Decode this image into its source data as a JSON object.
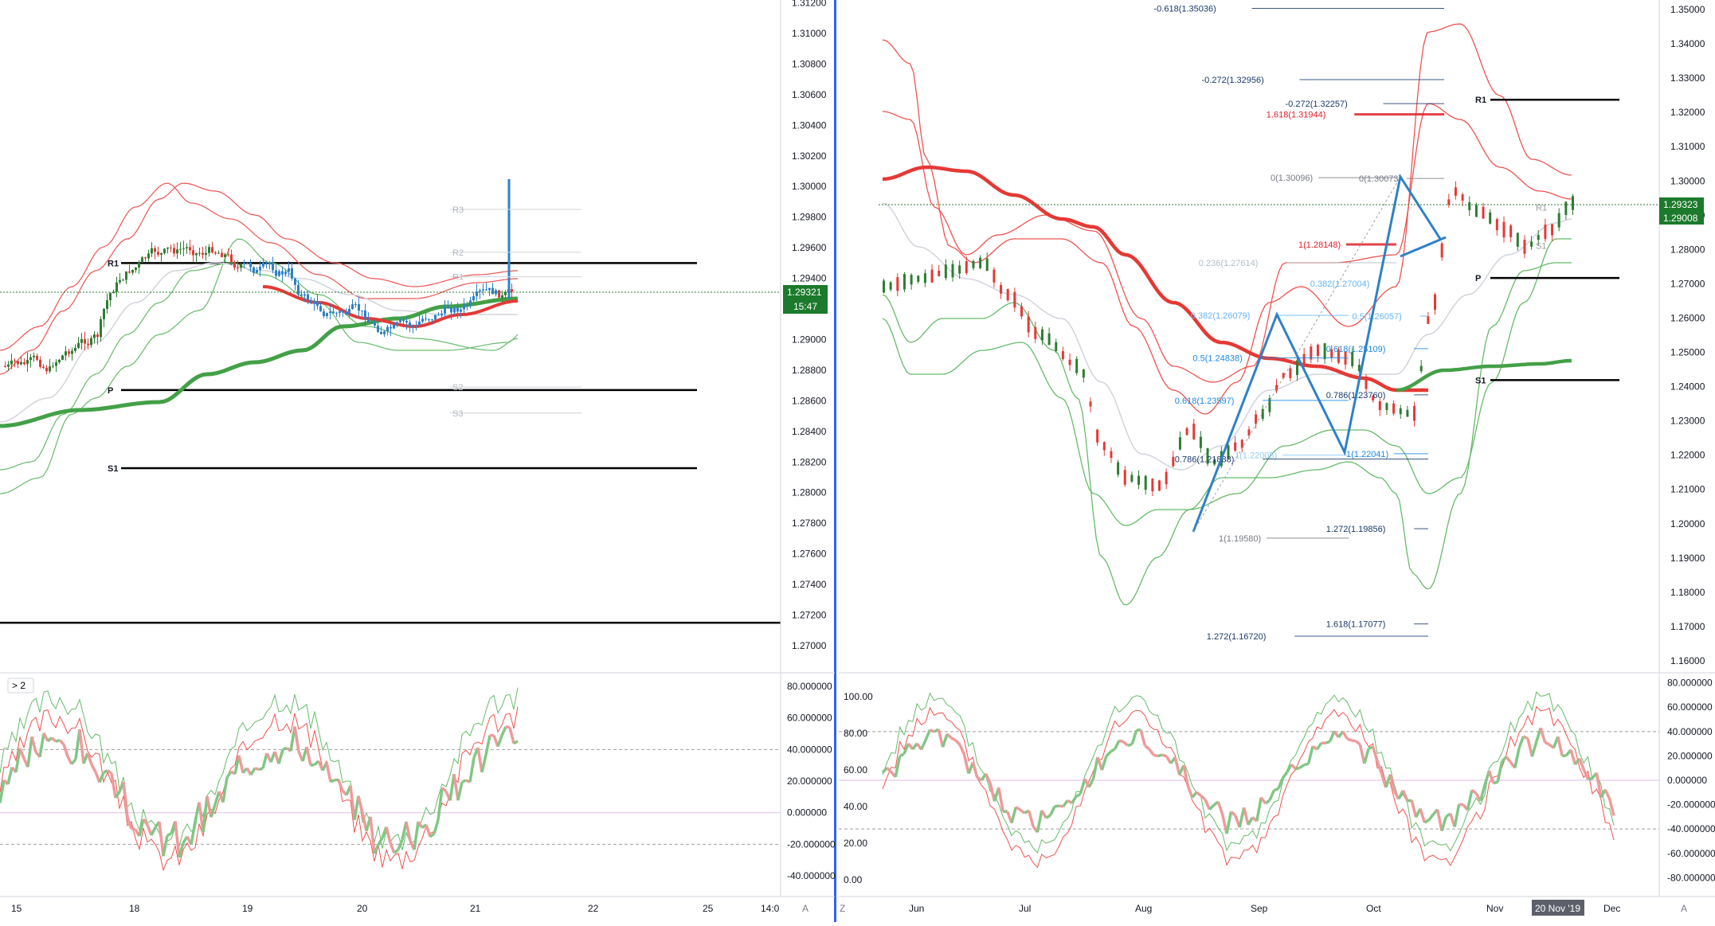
{
  "left_chart": {
    "price_axis_ticks": [
      "1.31200",
      "1.31000",
      "1.30800",
      "1.30600",
      "1.30400",
      "1.30200",
      "1.30000",
      "1.29800",
      "1.29600",
      "1.29400",
      "1.29200",
      "1.29000",
      "1.28800",
      "1.28600",
      "1.28400",
      "1.28200",
      "1.28000",
      "1.27800",
      "1.27600",
      "1.27400",
      "1.27200",
      "1.27000"
    ],
    "current_price": "1.29321",
    "countdown": "15:47",
    "pivot_labels": {
      "r1": "R1",
      "p": "P",
      "s1": "S1"
    },
    "faint_pivot_labels": [
      "R3",
      "R2",
      "R1",
      "S2",
      "S3"
    ],
    "oscillator_badge": "> 2",
    "oscillator_ticks": [
      "80.000000",
      "60.000000",
      "40.000000",
      "20.000000",
      "0.000000",
      "-20.000000",
      "-40.000000"
    ],
    "time_axis": [
      "15",
      "18",
      "19",
      "20",
      "21",
      "22",
      "25",
      "14:0"
    ],
    "time_axis_mode": "A"
  },
  "right_chart": {
    "price_axis_ticks": [
      "1.35000",
      "1.34000",
      "1.33000",
      "1.32000",
      "1.31000",
      "1.30000",
      "1.29000",
      "1.28000",
      "1.27000",
      "1.26000",
      "1.25000",
      "1.24000",
      "1.23000",
      "1.22000",
      "1.21000",
      "1.20000",
      "1.19000",
      "1.18000",
      "1.17000",
      "1.16000"
    ],
    "current_price": "1.29323",
    "secondary_price": "1.29008",
    "pivot_labels": {
      "r1": "R1",
      "p": "P",
      "s1": "S1"
    },
    "faint_pivot_labels": [
      "R1",
      "S1"
    ],
    "fib_labels": [
      {
        "text": "-0.618(1.35036)",
        "color": "#1a3a6b"
      },
      {
        "text": "-0.272(1.32956)",
        "color": "#1a3a6b"
      },
      {
        "text": "-0.272(1.32257)",
        "color": "#1a3a6b"
      },
      {
        "text": "1.618(1.31944)",
        "color": "#e0202a"
      },
      {
        "text": "0(1.30096)",
        "color": "#787b86"
      },
      {
        "text": "0(1.30073)",
        "color": "#787b86"
      },
      {
        "text": "1(1.28148)",
        "color": "#e0202a"
      },
      {
        "text": "0.236(1.27614)",
        "color": "#b0bec5"
      },
      {
        "text": "0.382(1.27004)",
        "color": "#64b5f6"
      },
      {
        "text": "0.382(1.26079)",
        "color": "#64b5f6"
      },
      {
        "text": "0.5(1.26057)",
        "color": "#64b5f6"
      },
      {
        "text": "0.618(1.25109)",
        "color": "#1e88e5"
      },
      {
        "text": "0.5(1.24838)",
        "color": "#1e88e5"
      },
      {
        "text": "0.786(1.23760)",
        "color": "#1a3a6b"
      },
      {
        "text": "0.618(1.23597)",
        "color": "#1e88e5"
      },
      {
        "text": "1(1.22005)",
        "color": "#90caf9"
      },
      {
        "text": "1(1.22041)",
        "color": "#1e88e5"
      },
      {
        "text": "0.786(1.21888)",
        "color": "#1a3a6b"
      },
      {
        "text": "1.272(1.19856)",
        "color": "#1a3a6b"
      },
      {
        "text": "1(1.19580)",
        "color": "#787b86"
      },
      {
        "text": "1.618(1.17077)",
        "color": "#1a3a6b"
      },
      {
        "text": "1.272(1.16720)",
        "color": "#1a3a6b"
      }
    ],
    "oscillator_left_ticks": [
      "100.00",
      "80.00",
      "60.00",
      "40.00",
      "20.00",
      "0.00"
    ],
    "oscillator_right_ticks": [
      "80.000000",
      "60.000000",
      "40.000000",
      "20.000000",
      "0.000000",
      "-20.000000",
      "-40.000000",
      "-60.000000",
      "-80.000000"
    ],
    "time_axis": [
      "Jun",
      "Jul",
      "Aug",
      "Sep",
      "Oct",
      "Nov",
      "Dec"
    ],
    "time_axis_highlight": "20 Nov '19",
    "time_axis_mode": "A",
    "zoom_label": "Z"
  },
  "colors": {
    "bull": "#26a69a",
    "bull_candle": "#2e7d32",
    "bear": "#e53935",
    "ema_red": "#e53935",
    "ema_green": "#43a047",
    "band_red": "#ef5350",
    "band_green": "#66bb6a",
    "pattern_blue": "#2f80c8",
    "price_tag": "#1b7a2b"
  },
  "chart_data": [
    {
      "type": "candlestick",
      "title": "",
      "ylim": [
        1.269,
        1.3125
      ],
      "xlabel": "",
      "ylabel": "",
      "pivots": {
        "R1": 1.295,
        "P": 1.2867,
        "S1": 1.2816
      },
      "extra_level": 1.2715,
      "current_price": 1.29321,
      "x": [
        "15",
        "18",
        "19",
        "20",
        "21",
        "22",
        "25"
      ],
      "oscillator": {
        "range": [
          -40,
          80
        ],
        "levels": [
          40,
          0,
          -20
        ]
      }
    },
    {
      "type": "candlestick",
      "title": "",
      "ylim": [
        1.155,
        1.352
      ],
      "xlabel": "",
      "ylabel": "",
      "pivots": {
        "R1": 1.3237,
        "P": 1.2717,
        "S1": 1.2419
      },
      "current_price": 1.29323,
      "x": [
        "Jun",
        "Jul",
        "Aug",
        "Sep",
        "Oct",
        "Nov",
        "Dec"
      ],
      "oscillator": {
        "range": [
          -80,
          80
        ],
        "levels": [
          40,
          -40
        ],
        "left_range": [
          0,
          100
        ]
      }
    }
  ]
}
